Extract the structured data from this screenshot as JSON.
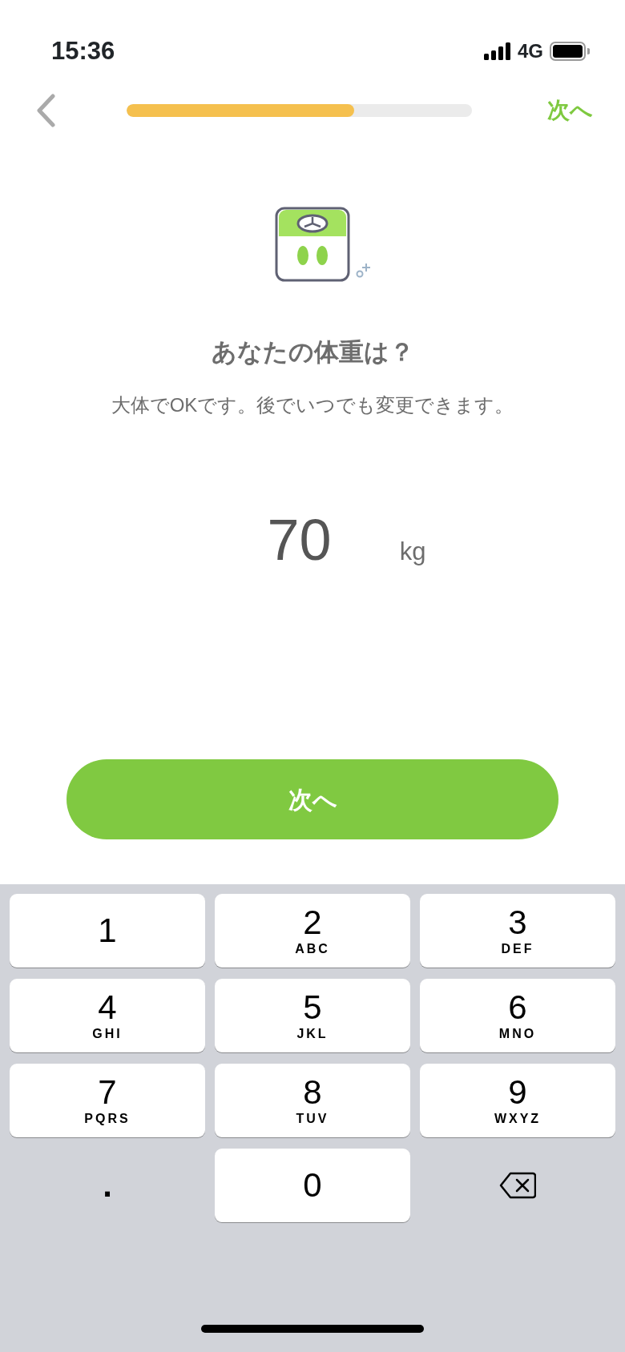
{
  "status_bar": {
    "time": "15:36",
    "network": "4G"
  },
  "nav": {
    "progress": {
      "level": 0.66
    },
    "skip_label": "次へ"
  },
  "question": {
    "title": "あなたの体重は？",
    "subtitle": "大体でOKです。後でいつでも変更できます。"
  },
  "weight": {
    "value": "70",
    "unit": "kg"
  },
  "next_button": {
    "label": "次へ"
  },
  "keypad": {
    "keys": [
      {
        "kind": "digit",
        "digit": "1"
      },
      {
        "kind": "digit",
        "digit": "2",
        "letters": "ABC"
      },
      {
        "kind": "digit",
        "digit": "3",
        "letters": "DEF"
      },
      {
        "kind": "digit",
        "digit": "4",
        "letters": "GHI"
      },
      {
        "kind": "digit",
        "digit": "5",
        "letters": "JKL"
      },
      {
        "kind": "digit",
        "digit": "6",
        "letters": "MNO"
      },
      {
        "kind": "digit",
        "digit": "7",
        "letters": "PQRS"
      },
      {
        "kind": "digit",
        "digit": "8",
        "letters": "TUV"
      },
      {
        "kind": "digit",
        "digit": "9",
        "letters": "WXYZ"
      },
      {
        "kind": "plain",
        "digit": "."
      },
      {
        "kind": "digit",
        "digit": "0"
      },
      {
        "kind": "delete"
      }
    ]
  }
}
